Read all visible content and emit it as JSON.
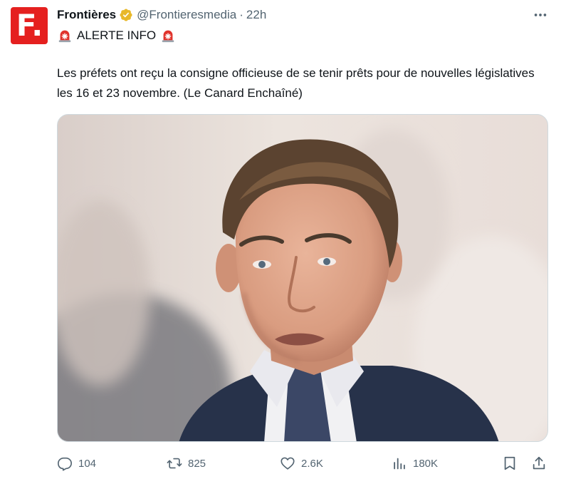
{
  "tweet": {
    "author_name": "Frontières",
    "handle": "@Frontieresmedia",
    "separator": "·",
    "time": "22h",
    "alert_label": "ALERTE INFO",
    "text": "Les préfets ont reçu la consigne officieuse de se tenir prêts pour de nouvelles législatives les 16 et 23 novembre. (Le Canard Enchaîné)",
    "avatar_letter": "F."
  },
  "metrics": {
    "replies": "104",
    "reposts": "825",
    "likes": "2.6K",
    "views": "180K"
  },
  "icons": {
    "more": "more-horizontal-icon",
    "verified": "verified-badge-icon",
    "siren": "siren-emoji-icon",
    "reply": "reply-icon",
    "repost": "repost-icon",
    "like": "heart-icon",
    "views": "analytics-icon",
    "bookmark": "bookmark-icon",
    "share": "share-icon"
  },
  "colors": {
    "brand_red": "#e5201f",
    "verified_gold": "#e8b829",
    "text_primary": "#0f1419",
    "text_secondary": "#536471",
    "siren_red": "#e0322b"
  }
}
